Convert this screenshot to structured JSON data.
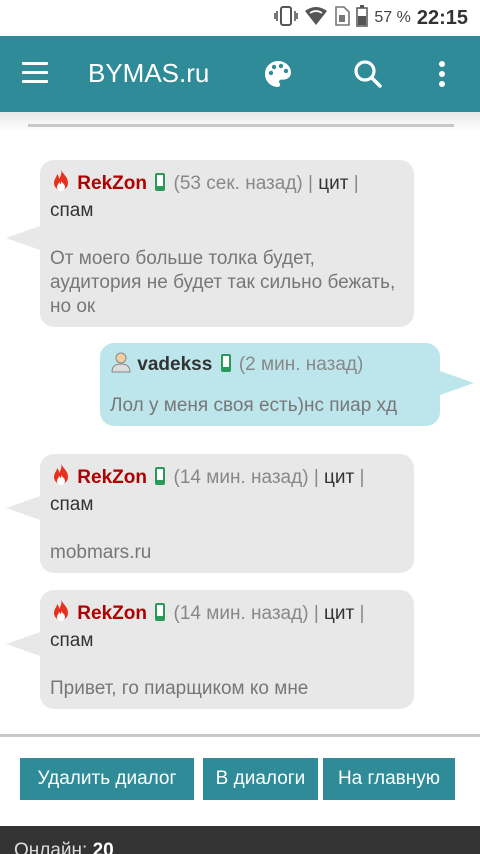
{
  "status_bar": {
    "battery_pct": "57 %",
    "time": "22:15"
  },
  "app_bar": {
    "title": "BYMAS.ru"
  },
  "messages": [
    {
      "author": "RekZon",
      "time": "(53 сек. назад)",
      "quote": "цит",
      "spam": "спам",
      "sep": "|",
      "text": "От моего больше толка будет, аудитория не будет так сильно бежать, но ок"
    },
    {
      "author": "vadekss",
      "time": "(2 мин. назад)",
      "text": "Лол у меня своя есть)нс пиар хд"
    },
    {
      "author": "RekZon",
      "time": "(14 мин. назад)",
      "quote": "цит",
      "spam": "спам",
      "sep": "|",
      "text": "mobmars.ru"
    },
    {
      "author": "RekZon",
      "time": "(14 мин. назад)",
      "quote": "цит",
      "spam": "спам",
      "sep": "|",
      "text": "Привет, го пиарщиком ко мне"
    }
  ],
  "buttons": {
    "delete_dialog": "Удалить диалог",
    "to_dialogs": "В диалоги",
    "home": "На главную"
  },
  "footer": {
    "online_label": "Онлайн:",
    "online_count": "20"
  },
  "colors": {
    "accent": "#2e8b97",
    "incoming_bubble": "#e8e8e8",
    "outgoing_bubble": "#bde6ec",
    "author_red": "#b00000",
    "footer_bg": "#333333"
  }
}
